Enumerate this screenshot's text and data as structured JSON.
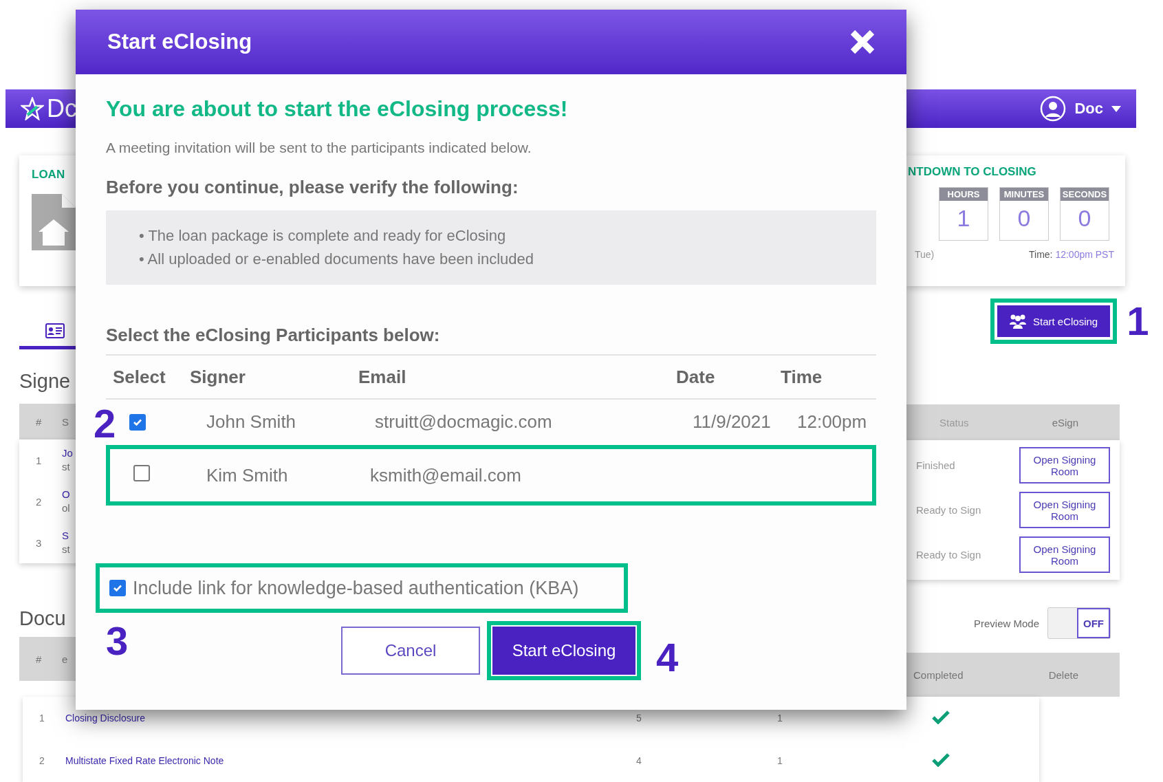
{
  "app_bar": {
    "logo_text": "Dc",
    "user": "Doc"
  },
  "loan_card": {
    "label": "LOAN"
  },
  "countdown": {
    "title": "NTDOWN TO CLOSING",
    "units": [
      {
        "label": "HOURS",
        "value": "1"
      },
      {
        "label": "MINUTES",
        "value": "0"
      },
      {
        "label": "SECONDS",
        "value": "0"
      }
    ],
    "date": "Tue)",
    "time_label": "Time:",
    "time": "12:00pm PST"
  },
  "start_button": {
    "label": "Start eClosing",
    "annotation": "1"
  },
  "signers": {
    "title": "Signe",
    "columns": [
      "#",
      "S"
    ],
    "right_columns": [
      "Status",
      "eSign"
    ],
    "rows": [
      {
        "num": "1",
        "name": "Jo",
        "email": "st",
        "status": "Finished",
        "action": "Open Signing Room"
      },
      {
        "num": "2",
        "name": "O",
        "email": "ol",
        "status": "Ready to Sign",
        "action": "Open Signing Room"
      },
      {
        "num": "3",
        "name": "S",
        "email": "st",
        "status": "Ready to Sign",
        "action": "Open Signing Room"
      }
    ]
  },
  "preview_mode": {
    "label": "Preview Mode",
    "state": "OFF",
    "on": false
  },
  "documents": {
    "title": "Docu",
    "columns": [
      "#",
      "e"
    ],
    "right_columns": [
      "Completed",
      "Delete"
    ],
    "rows": [
      {
        "num": "1",
        "name": "Closing Disclosure",
        "column_3": "5",
        "column_4": "1",
        "completed": true
      },
      {
        "num": "2",
        "name": "Multistate Fixed Rate Electronic Note",
        "column_3": "4",
        "column_4": "1",
        "completed": true
      }
    ]
  },
  "modal": {
    "title": "Start eClosing",
    "heading": "You are about to start the eClosing process!",
    "intro": "A meeting invitation will be sent to the participants indicated below.",
    "verify_title": "Before you continue, please verify the following:",
    "checklist": [
      "• The loan package is complete and ready for eClosing",
      "• All uploaded or e-enabled documents have been included"
    ],
    "participants_title": "Select the eClosing Participants below:",
    "columns": [
      "Select",
      "Signer",
      "Email",
      "Date",
      "Time"
    ],
    "participants": [
      {
        "checked": true,
        "name": "John Smith",
        "email": "struitt@docmagic.com",
        "date": "11/9/2021",
        "time": "12:00pm"
      },
      {
        "checked": false,
        "name": "Kim Smith",
        "email": "ksmith@email.com",
        "annotation": "2"
      }
    ],
    "kba": {
      "label": "Include link for knowledge-based authentication (KBA)",
      "checked": true,
      "annotation": "3"
    },
    "buttons": [
      {
        "label": "Cancel",
        "kind": "secondary"
      },
      {
        "label": "Start eClosing",
        "kind": "primary",
        "annotation": "4"
      }
    ]
  }
}
